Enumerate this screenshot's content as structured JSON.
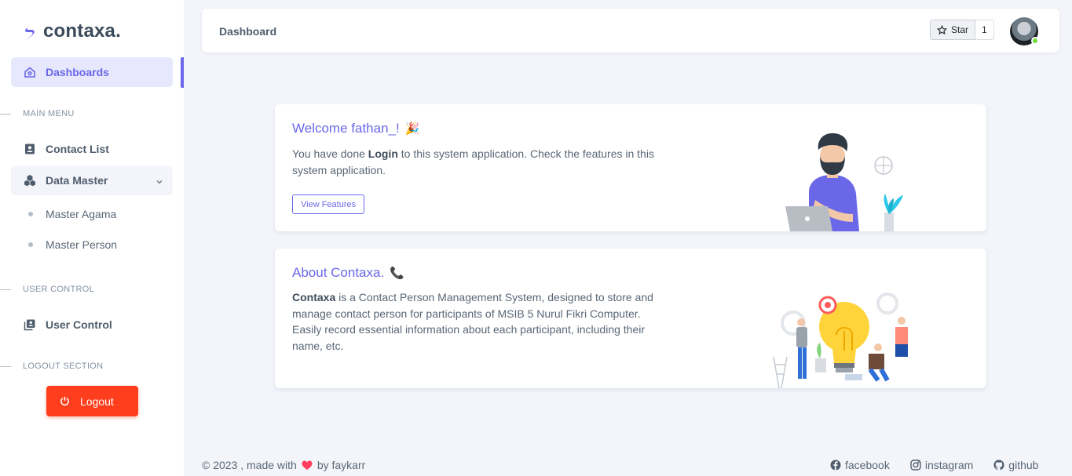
{
  "brand": {
    "name": "contaxa."
  },
  "sidebar": {
    "dashboards": "Dashboards",
    "section_main": "MAIN MENU",
    "contact_list": "Contact List",
    "data_master": "Data Master",
    "master_agama": "Master Agama",
    "master_person": "Master Person",
    "section_user": "USER CONTROL",
    "user_control": "User Control",
    "section_logout": "LOGOUT SECTION",
    "logout": "Logout"
  },
  "topbar": {
    "title": "Dashboard",
    "star_label": "Star",
    "star_count": "1"
  },
  "welcome": {
    "title": "Welcome fathan_!",
    "emoji": "🎉",
    "text_pre": "You have done ",
    "text_bold": "Login",
    "text_post": " to this system application. Check the features in this system application.",
    "button": "View Features"
  },
  "about": {
    "title": "About Contaxa.",
    "emoji": "📞",
    "text_bold": "Contaxa",
    "text_post": " is a Contact Person Management System, designed to store and manage contact person for participants of MSIB 5 Nurul Fikri Computer. Easily record essential information about each participant, including their name, etc."
  },
  "footer": {
    "copyright": "© 2023 , made with",
    "by": "by faykarr",
    "facebook": "facebook",
    "instagram": "instagram",
    "github": "github"
  },
  "colors": {
    "primary": "#6a68e8",
    "danger": "#ff3e1d",
    "online": "#71dd37",
    "background": "#f4f5fb"
  }
}
